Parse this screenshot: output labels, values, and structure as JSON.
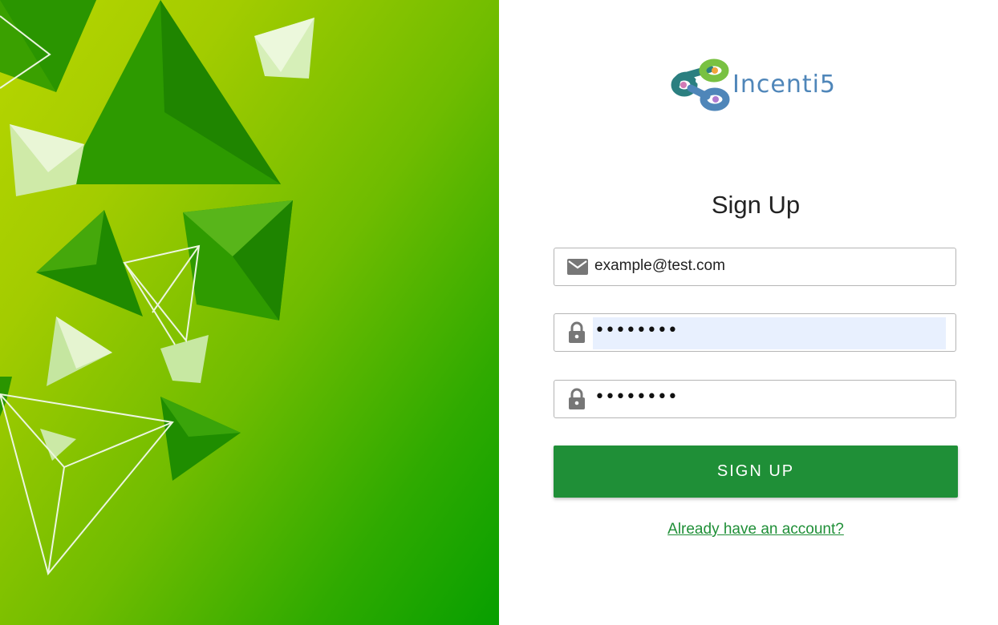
{
  "brand": {
    "name": "Incenti5",
    "logo_colors": [
      "#79c142",
      "#4f86b9",
      "#2b7f80"
    ],
    "accent_color": "#1f8f37"
  },
  "form": {
    "title": "Sign Up",
    "email": {
      "icon": "mail-icon",
      "value": "example@test.com"
    },
    "password": {
      "icon": "lock-icon",
      "masked_value": "••••••••"
    },
    "confirm_password": {
      "icon": "lock-icon",
      "masked_value": "••••••••"
    },
    "submit_label": "SIGN UP",
    "login_link": "Already have an account?"
  },
  "hero": {
    "image": "green-abstract-pyramids"
  }
}
